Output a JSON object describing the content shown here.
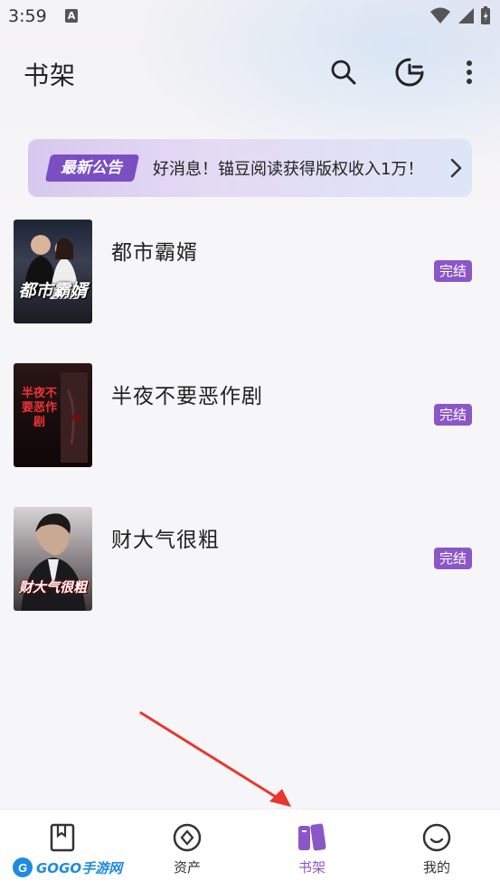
{
  "status_bar": {
    "time": "3:59",
    "notification_letter": "A"
  },
  "header": {
    "title": "书架"
  },
  "notice": {
    "tag": "最新公告",
    "text": "好消息！锚豆阅读获得版权收入1万！"
  },
  "books": [
    {
      "title": "都市霸婿",
      "badge": "完结",
      "cover_text": "都市霸婿"
    },
    {
      "title": "半夜不要恶作剧",
      "badge": "完结",
      "cover_text": "半夜不要恶作剧"
    },
    {
      "title": "财大气很粗",
      "badge": "完结",
      "cover_text": "财大气很粗"
    }
  ],
  "bottom_nav": [
    {
      "label": "",
      "icon": "book-icon"
    },
    {
      "label": "资产",
      "icon": "coin-icon"
    },
    {
      "label": "书架",
      "icon": "bookshelf-icon",
      "active": true
    },
    {
      "label": "我的",
      "icon": "smile-icon"
    }
  ],
  "watermark": {
    "text": "GOGO手游网"
  },
  "colors": {
    "accent": "#8a56c8",
    "notice_tag": "#7a4fc2",
    "arrow": "#e8372c"
  }
}
